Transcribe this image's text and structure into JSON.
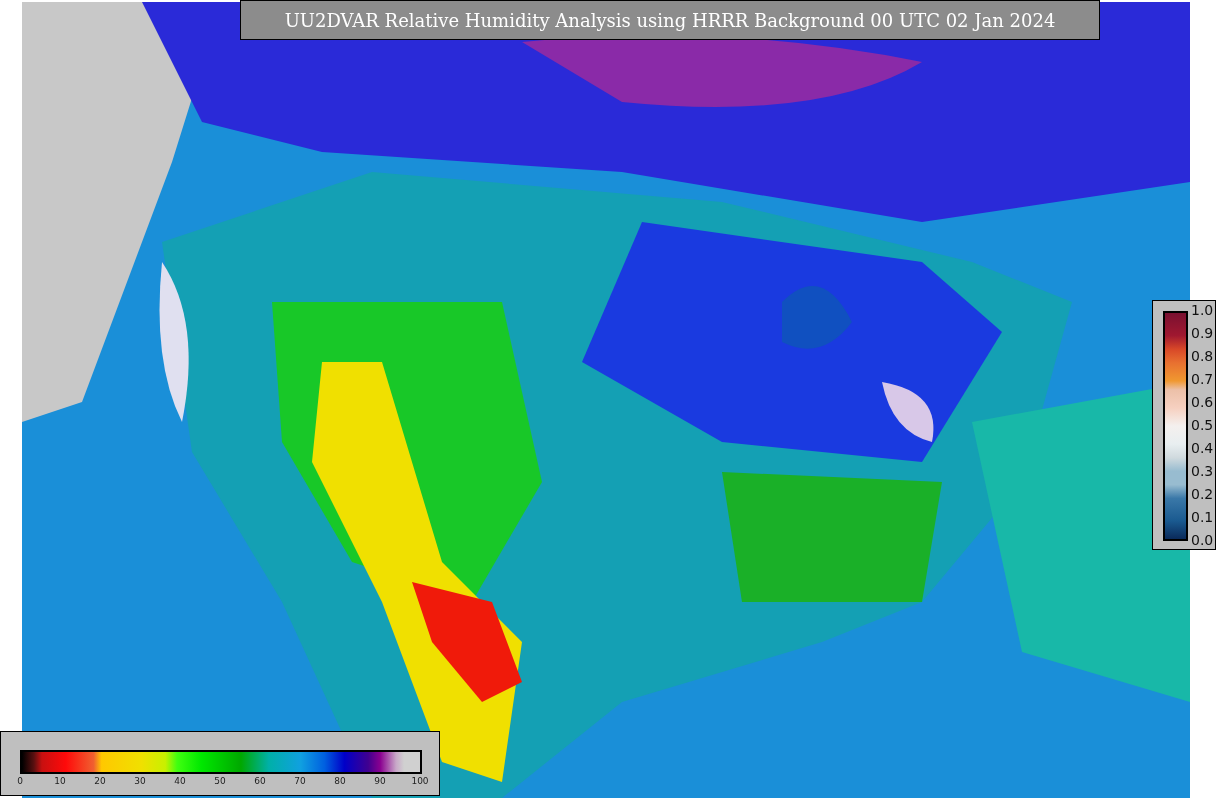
{
  "title": "UU2DVAR Relative Humidity Analysis using HRRR Background 00 UTC 02 Jan 2024",
  "bottom_colorbar": {
    "ticks": [
      "0",
      "10",
      "20",
      "30",
      "40",
      "50",
      "60",
      "70",
      "80",
      "90",
      "100"
    ]
  },
  "right_colorbar": {
    "ticks": [
      "1.0",
      "0.9",
      "0.8",
      "0.7",
      "0.6",
      "0.5",
      "0.4",
      "0.3",
      "0.2",
      "0.1",
      "0.0"
    ]
  }
}
